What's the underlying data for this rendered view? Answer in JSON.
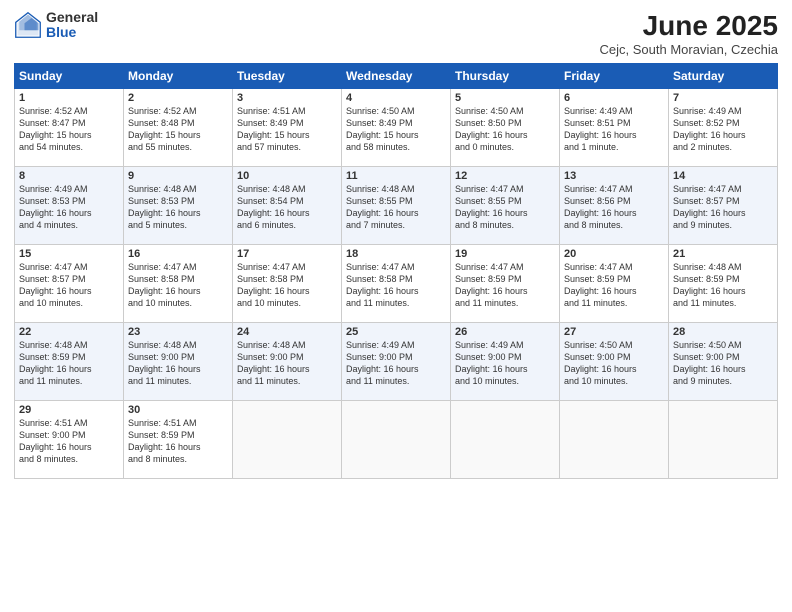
{
  "logo": {
    "general": "General",
    "blue": "Blue"
  },
  "title": "June 2025",
  "subtitle": "Cejc, South Moravian, Czechia",
  "days_header": [
    "Sunday",
    "Monday",
    "Tuesday",
    "Wednesday",
    "Thursday",
    "Friday",
    "Saturday"
  ],
  "weeks": [
    [
      {
        "day": "1",
        "info": "Sunrise: 4:52 AM\nSunset: 8:47 PM\nDaylight: 15 hours\nand 54 minutes."
      },
      {
        "day": "2",
        "info": "Sunrise: 4:52 AM\nSunset: 8:48 PM\nDaylight: 15 hours\nand 55 minutes."
      },
      {
        "day": "3",
        "info": "Sunrise: 4:51 AM\nSunset: 8:49 PM\nDaylight: 15 hours\nand 57 minutes."
      },
      {
        "day": "4",
        "info": "Sunrise: 4:50 AM\nSunset: 8:49 PM\nDaylight: 15 hours\nand 58 minutes."
      },
      {
        "day": "5",
        "info": "Sunrise: 4:50 AM\nSunset: 8:50 PM\nDaylight: 16 hours\nand 0 minutes."
      },
      {
        "day": "6",
        "info": "Sunrise: 4:49 AM\nSunset: 8:51 PM\nDaylight: 16 hours\nand 1 minute."
      },
      {
        "day": "7",
        "info": "Sunrise: 4:49 AM\nSunset: 8:52 PM\nDaylight: 16 hours\nand 2 minutes."
      }
    ],
    [
      {
        "day": "8",
        "info": "Sunrise: 4:49 AM\nSunset: 8:53 PM\nDaylight: 16 hours\nand 4 minutes."
      },
      {
        "day": "9",
        "info": "Sunrise: 4:48 AM\nSunset: 8:53 PM\nDaylight: 16 hours\nand 5 minutes."
      },
      {
        "day": "10",
        "info": "Sunrise: 4:48 AM\nSunset: 8:54 PM\nDaylight: 16 hours\nand 6 minutes."
      },
      {
        "day": "11",
        "info": "Sunrise: 4:48 AM\nSunset: 8:55 PM\nDaylight: 16 hours\nand 7 minutes."
      },
      {
        "day": "12",
        "info": "Sunrise: 4:47 AM\nSunset: 8:55 PM\nDaylight: 16 hours\nand 8 minutes."
      },
      {
        "day": "13",
        "info": "Sunrise: 4:47 AM\nSunset: 8:56 PM\nDaylight: 16 hours\nand 8 minutes."
      },
      {
        "day": "14",
        "info": "Sunrise: 4:47 AM\nSunset: 8:57 PM\nDaylight: 16 hours\nand 9 minutes."
      }
    ],
    [
      {
        "day": "15",
        "info": "Sunrise: 4:47 AM\nSunset: 8:57 PM\nDaylight: 16 hours\nand 10 minutes."
      },
      {
        "day": "16",
        "info": "Sunrise: 4:47 AM\nSunset: 8:58 PM\nDaylight: 16 hours\nand 10 minutes."
      },
      {
        "day": "17",
        "info": "Sunrise: 4:47 AM\nSunset: 8:58 PM\nDaylight: 16 hours\nand 10 minutes."
      },
      {
        "day": "18",
        "info": "Sunrise: 4:47 AM\nSunset: 8:58 PM\nDaylight: 16 hours\nand 11 minutes."
      },
      {
        "day": "19",
        "info": "Sunrise: 4:47 AM\nSunset: 8:59 PM\nDaylight: 16 hours\nand 11 minutes."
      },
      {
        "day": "20",
        "info": "Sunrise: 4:47 AM\nSunset: 8:59 PM\nDaylight: 16 hours\nand 11 minutes."
      },
      {
        "day": "21",
        "info": "Sunrise: 4:48 AM\nSunset: 8:59 PM\nDaylight: 16 hours\nand 11 minutes."
      }
    ],
    [
      {
        "day": "22",
        "info": "Sunrise: 4:48 AM\nSunset: 8:59 PM\nDaylight: 16 hours\nand 11 minutes."
      },
      {
        "day": "23",
        "info": "Sunrise: 4:48 AM\nSunset: 9:00 PM\nDaylight: 16 hours\nand 11 minutes."
      },
      {
        "day": "24",
        "info": "Sunrise: 4:48 AM\nSunset: 9:00 PM\nDaylight: 16 hours\nand 11 minutes."
      },
      {
        "day": "25",
        "info": "Sunrise: 4:49 AM\nSunset: 9:00 PM\nDaylight: 16 hours\nand 11 minutes."
      },
      {
        "day": "26",
        "info": "Sunrise: 4:49 AM\nSunset: 9:00 PM\nDaylight: 16 hours\nand 10 minutes."
      },
      {
        "day": "27",
        "info": "Sunrise: 4:50 AM\nSunset: 9:00 PM\nDaylight: 16 hours\nand 10 minutes."
      },
      {
        "day": "28",
        "info": "Sunrise: 4:50 AM\nSunset: 9:00 PM\nDaylight: 16 hours\nand 9 minutes."
      }
    ],
    [
      {
        "day": "29",
        "info": "Sunrise: 4:51 AM\nSunset: 9:00 PM\nDaylight: 16 hours\nand 8 minutes."
      },
      {
        "day": "30",
        "info": "Sunrise: 4:51 AM\nSunset: 8:59 PM\nDaylight: 16 hours\nand 8 minutes."
      },
      {
        "day": "",
        "info": ""
      },
      {
        "day": "",
        "info": ""
      },
      {
        "day": "",
        "info": ""
      },
      {
        "day": "",
        "info": ""
      },
      {
        "day": "",
        "info": ""
      }
    ]
  ]
}
